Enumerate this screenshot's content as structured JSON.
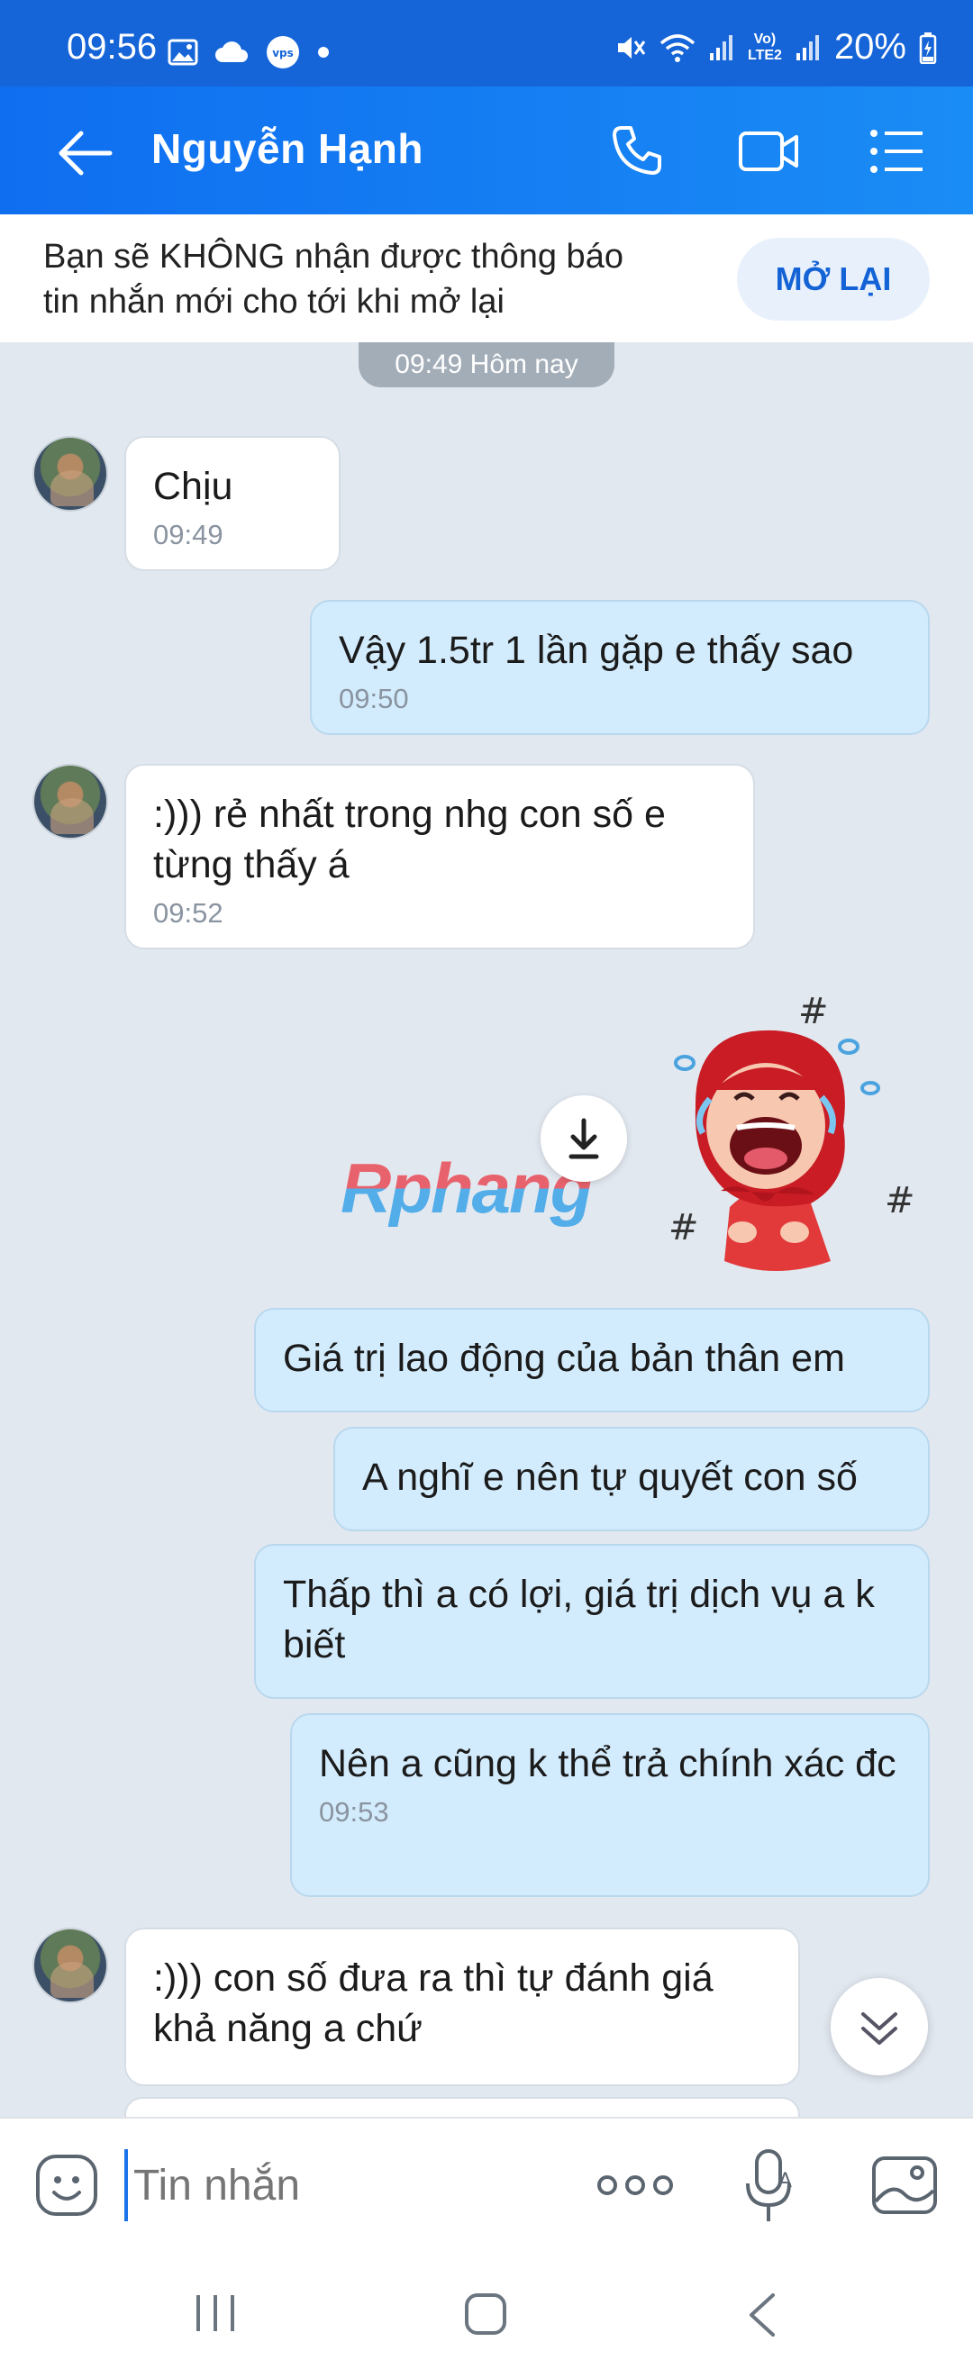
{
  "status_bar": {
    "time": "09:56",
    "battery": "20%",
    "network_label_line1": "Vo)",
    "network_label_line2": "LTE2"
  },
  "header": {
    "contact_name": "Nguyễn Hạnh"
  },
  "notice": {
    "line1": "Bạn sẽ KHÔNG nhận được thông báo",
    "line2": "tin nhắn mới cho tới khi mở lại",
    "button_label": "MỞ LẠI"
  },
  "date_divider": "09:49 Hôm nay",
  "messages": [
    {
      "dir": "in",
      "text": "Chịu",
      "time": "09:49"
    },
    {
      "dir": "out",
      "text": "Vậy 1.5tr 1 lần gặp e thấy sao",
      "time": "09:50"
    },
    {
      "dir": "in",
      "text": ":))) rẻ nhất trong nhg con số e từng thấy á",
      "time": "09:52"
    },
    {
      "dir": "out",
      "text": "Giá trị lao động của bản thân em",
      "time": ""
    },
    {
      "dir": "out",
      "text": "A nghĩ e nên tự quyết con số",
      "time": ""
    },
    {
      "dir": "out",
      "text": "Thấp thì a có lợi, giá trị dịch vụ a k biết",
      "time": ""
    },
    {
      "dir": "out",
      "text": "Nên a cũng k thể trả chính xác đc",
      "time": "09:53"
    },
    {
      "dir": "in",
      "text": ":))) con số đưa ra thì tự đánh giá khả năng a chứ",
      "time": ""
    }
  ],
  "sticker": {
    "watermark": "Rphang",
    "description_icon": "crying-laughing-girl-sticker"
  },
  "composer": {
    "placeholder": "Tin nhắn"
  },
  "colors": {
    "header_blue": "#1a7ff2",
    "outgoing_bubble": "#d3ecfd",
    "incoming_bubble": "#ffffff",
    "chat_background": "#e2e8f0"
  }
}
